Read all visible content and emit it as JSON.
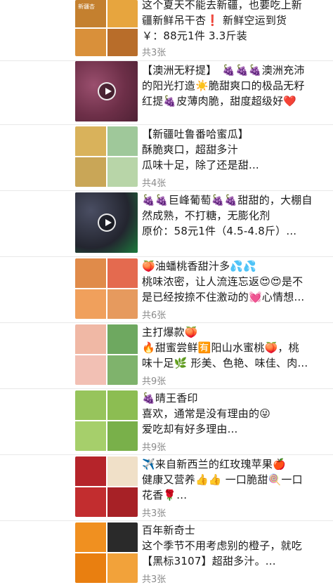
{
  "posts": [
    {
      "lines": [
        "这个夏天不能去新疆，也要吃上新",
        "疆新鲜吊干杏❗ 新鲜空运到货",
        "￥：88元1件 3.3斤装"
      ],
      "photo_label": "新疆杏",
      "count": "共3张",
      "video": false,
      "colors": [
        "#c4802f",
        "#e7a53e",
        "#d9903a",
        "#b86d2a"
      ]
    },
    {
      "lines": [
        "【澳洲无籽提】　🍇🍇🍇澳洲充沛",
        "的阳光打造☀️脆甜爽口的极品无籽",
        "红提🍇皮薄肉脆，甜度超级好❤️"
      ],
      "count": "",
      "video": true,
      "colors": [
        "#7a3b55"
      ]
    },
    {
      "lines": [
        "【新疆吐鲁番哈蜜瓜】",
        "酥脆爽口，超甜多汁",
        "瓜味十足，除了还是甜..."
      ],
      "count": "共4张",
      "video": false,
      "colors": [
        "#d9b25b",
        "#9fc89a",
        "#c9a657",
        "#b8d5a8"
      ]
    },
    {
      "lines": [
        "🍇🍇巨峰葡萄🍇🍇甜甜的，大棚自",
        "然成熟，不打糖，无膨化剂",
        "原价：58元1件（4.5-4.8斤）..."
      ],
      "count": "",
      "video": true,
      "colors": [
        "#2d2f3d"
      ]
    },
    {
      "lines": [
        "🍑油蟠桃香甜汁多💦💦",
        "桃味浓密，让人流连忘返😍😍是不",
        "是已经按捺不住激动的💓心情想..."
      ],
      "count": "共6张",
      "video": false,
      "colors": [
        "#e08b4a",
        "#e46a4f",
        "#f0a05c",
        "#e69a5e"
      ]
    },
    {
      "lines": [
        "主打爆款🍑",
        "🔥甜蜜尝鲜🈶阳山水蜜桃🍑，桃",
        "味十足🌿 形美、色艳、味佳、肉..."
      ],
      "count": "共9张",
      "video": false,
      "colors": [
        "#f0b8a5",
        "#6ea860",
        "#f2c0b4",
        "#7fb36c"
      ]
    },
    {
      "lines": [
        "🍇晴王香印",
        "喜欢，通常是没有理由的😜",
        "爱吃却有好多理由..."
      ],
      "count": "共9张",
      "video": false,
      "colors": [
        "#97c45c",
        "#8cbd52",
        "#a6cf6b",
        "#79b04a"
      ]
    },
    {
      "lines": [
        "✈️来自新西兰的红玫瑰苹果🍎",
        "健康又营养👍👍 一口脆甜🍭一口",
        "花香🌹..."
      ],
      "count": "共3张",
      "video": false,
      "colors": [
        "#b5242a",
        "#f0e0c8",
        "#c22d2f",
        "#a72126"
      ]
    },
    {
      "lines": [
        "百年新奇士",
        "这个季节不用考虑别的橙子，就吃",
        "【黑标3107】超甜多汁。..."
      ],
      "count": "共3张",
      "video": false,
      "colors": [
        "#f09020",
        "#2a2a2a",
        "#e97f10",
        "#f2a23a"
      ]
    }
  ]
}
